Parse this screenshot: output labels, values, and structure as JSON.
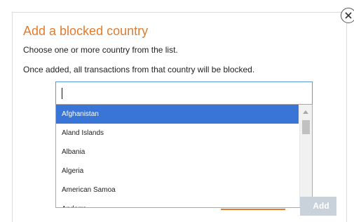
{
  "dialog": {
    "title": "Add a blocked country",
    "instruction": "Choose one or more country from the list.",
    "warning": "Once added, all transactions from that country will be blocked."
  },
  "search": {
    "value": ""
  },
  "countries": [
    {
      "label": "Afghanistan",
      "selected": true
    },
    {
      "label": "Aland Islands",
      "selected": false
    },
    {
      "label": "Albania",
      "selected": false
    },
    {
      "label": "Algeria",
      "selected": false
    },
    {
      "label": "American Samoa",
      "selected": false
    },
    {
      "label": "Andorra",
      "selected": false
    }
  ],
  "buttons": {
    "add_label": "Add"
  },
  "icons": {
    "close": "close-icon",
    "scroll_up": "scroll-up-arrow-icon",
    "scroll_down": "scroll-down-arrow-icon"
  },
  "colors": {
    "title": "#e27c2d",
    "selected_row": "#3875d7",
    "input_border": "#5b9bd5",
    "add_button_disabled": "#c9d1db"
  }
}
